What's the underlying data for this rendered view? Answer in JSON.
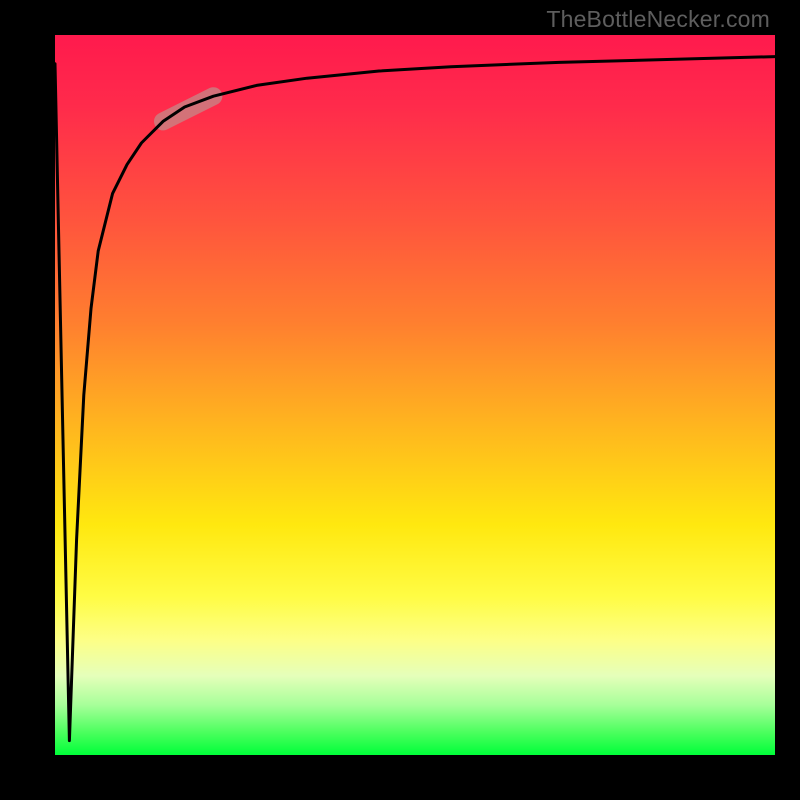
{
  "watermark": "TheBottleNecker.com",
  "chart_data": {
    "type": "line",
    "title": "",
    "xlabel": "",
    "ylabel": "",
    "xlim": [
      0,
      100
    ],
    "ylim": [
      0,
      100
    ],
    "background_gradient": {
      "orientation": "vertical",
      "stops": [
        {
          "pos": 0,
          "color": "#ff1a4d"
        },
        {
          "pos": 26,
          "color": "#ff553d"
        },
        {
          "pos": 55,
          "color": "#ffb81e"
        },
        {
          "pos": 78,
          "color": "#fffc44"
        },
        {
          "pos": 100,
          "color": "#00ff39"
        }
      ]
    },
    "series": [
      {
        "name": "curve",
        "x": [
          0,
          2,
          3,
          4,
          5,
          6,
          8,
          10,
          12,
          15,
          18,
          22,
          28,
          35,
          45,
          55,
          70,
          85,
          100
        ],
        "y": [
          96,
          2,
          30,
          50,
          62,
          70,
          78,
          82,
          85,
          88,
          90,
          91.5,
          93,
          94,
          95,
          95.6,
          96.2,
          96.6,
          97
        ]
      }
    ],
    "highlight_segment": {
      "series": "curve",
      "x_start": 15,
      "x_end": 22,
      "note": "short thick semi-transparent marker overlaying the steep section"
    }
  }
}
